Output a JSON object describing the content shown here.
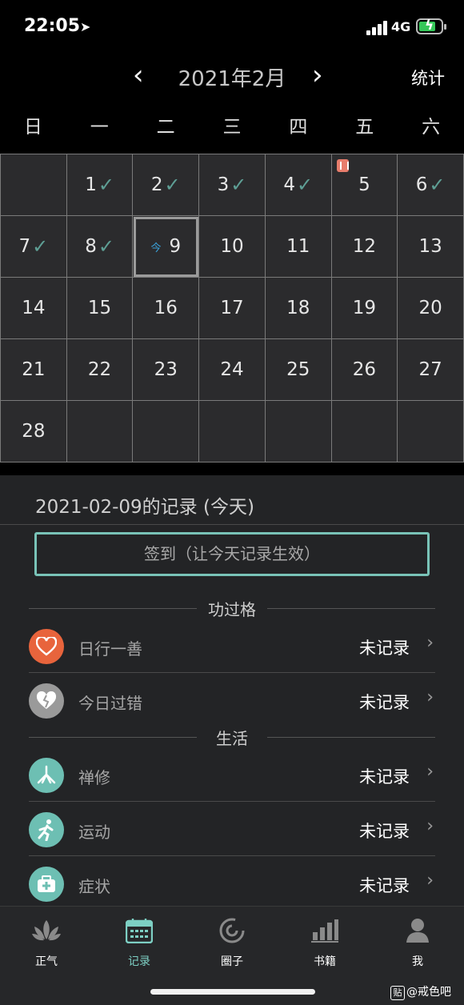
{
  "status": {
    "time": "22:05",
    "network": "4G",
    "battery_charging": true
  },
  "header": {
    "prev_icon": "‹",
    "next_icon": "›",
    "title": "2021年2月",
    "stats_label": "统计"
  },
  "weekdays": [
    "日",
    "一",
    "二",
    "三",
    "四",
    "五",
    "六"
  ],
  "calendar": {
    "cells": [
      {
        "day": "",
        "checked": false
      },
      {
        "day": "1",
        "checked": true
      },
      {
        "day": "2",
        "checked": true
      },
      {
        "day": "3",
        "checked": true
      },
      {
        "day": "4",
        "checked": true
      },
      {
        "day": "5",
        "checked": false,
        "marker": true
      },
      {
        "day": "6",
        "checked": true
      },
      {
        "day": "7",
        "checked": true
      },
      {
        "day": "8",
        "checked": true
      },
      {
        "day": "9",
        "checked": false,
        "today": true,
        "today_tag": "今"
      },
      {
        "day": "10"
      },
      {
        "day": "11"
      },
      {
        "day": "12"
      },
      {
        "day": "13"
      },
      {
        "day": "14"
      },
      {
        "day": "15"
      },
      {
        "day": "16"
      },
      {
        "day": "17"
      },
      {
        "day": "18"
      },
      {
        "day": "19"
      },
      {
        "day": "20"
      },
      {
        "day": "21"
      },
      {
        "day": "22"
      },
      {
        "day": "23"
      },
      {
        "day": "24"
      },
      {
        "day": "25"
      },
      {
        "day": "26"
      },
      {
        "day": "27"
      },
      {
        "day": "28"
      },
      {
        "day": ""
      },
      {
        "day": ""
      },
      {
        "day": ""
      },
      {
        "day": ""
      },
      {
        "day": ""
      },
      {
        "day": ""
      }
    ]
  },
  "record": {
    "title": "2021-02-09的记录 (今天)",
    "checkin_label": "签到（让今天记录生效）"
  },
  "sections": {
    "merit": "功过格",
    "life": "生活"
  },
  "rows": {
    "good_deed": {
      "label": "日行一善",
      "value": "未记录",
      "icon": "heart-icon",
      "color": "#e8643c"
    },
    "mistake": {
      "label": "今日过错",
      "value": "未记录",
      "icon": "broken-heart-icon",
      "color": "#9a9a9a"
    },
    "meditation": {
      "label": "禅修",
      "value": "未记录",
      "icon": "meditation-icon",
      "color": "#6dbfb3"
    },
    "exercise": {
      "label": "运动",
      "value": "未记录",
      "icon": "running-icon",
      "color": "#6dbfb3"
    },
    "symptoms": {
      "label": "症状",
      "value": "未记录",
      "icon": "medkit-icon",
      "color": "#6dbfb3"
    }
  },
  "tabs": [
    {
      "label": "正气",
      "icon": "lotus-icon"
    },
    {
      "label": "记录",
      "icon": "calendar-icon",
      "active": true
    },
    {
      "label": "圈子",
      "icon": "circle-icon"
    },
    {
      "label": "书籍",
      "icon": "bar-chart-icon"
    },
    {
      "label": "我",
      "icon": "person-icon"
    }
  ],
  "watermark": {
    "badge": "贴",
    "text": "@戒色吧"
  },
  "colors": {
    "accent": "#7dcfc3",
    "check": "#5e9f95",
    "today_tag": "#3aa0d8"
  }
}
